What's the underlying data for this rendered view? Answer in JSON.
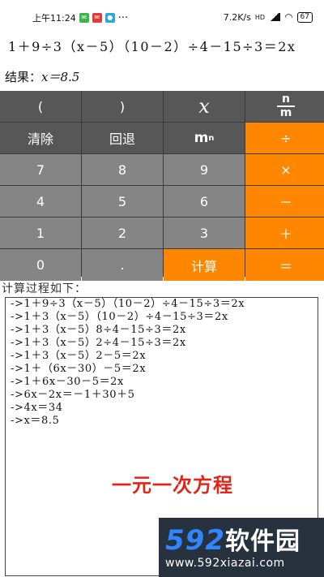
{
  "status_bar": {
    "time": "上午11:24",
    "network_speed": "7.2K/s",
    "network_type": "HD",
    "battery": "67",
    "icons": [
      "wechat-icon",
      "weibo-icon",
      "app-icon",
      "more-icon",
      "wifi-icon",
      "signal-icon"
    ]
  },
  "expression": "1＋9÷3（x－5）（10－2）÷4－15÷3＝2x",
  "result": {
    "label": "结果：",
    "value": "x＝8.5"
  },
  "keypad": {
    "keys": [
      "(",
      ")",
      "x",
      "n/m",
      "清除",
      "回退",
      "mⁿ",
      "÷",
      "7",
      "8",
      "9",
      "×",
      "4",
      "5",
      "6",
      "－",
      "1",
      "2",
      "3",
      "＋",
      "0",
      ".",
      "计算",
      "＝"
    ],
    "frac_top": "n",
    "frac_bottom": "m",
    "pow_base": "m",
    "pow_exp": "n"
  },
  "process": {
    "title": "计算过程如下：",
    "steps": [
      "->1＋9÷3（x－5）（10－2）÷4－15÷3＝2x",
      "->1＋3（x－5）（10－2）÷4－15÷3＝2x",
      "->1＋3（x－5）8÷4－15÷3＝2x",
      "->1＋3（x－5）2÷4－15÷3＝2x",
      "->1＋3（x－5）2－5＝2x",
      "->1＋（6x－30）－5＝2x",
      "->1＋6x－30－5＝2x",
      "->6x－2x＝－1＋30＋5",
      "->4x＝34",
      "->x＝8.5"
    ],
    "annotation": "一元一次方程"
  },
  "watermark": {
    "logo_num": "592",
    "logo_cn": "软件园",
    "url": "www.592xiazai.com"
  },
  "colors": {
    "orange": "#ff8700",
    "dark_key": "#575757",
    "mid_key": "#858585",
    "annotation": "#e0251b"
  }
}
